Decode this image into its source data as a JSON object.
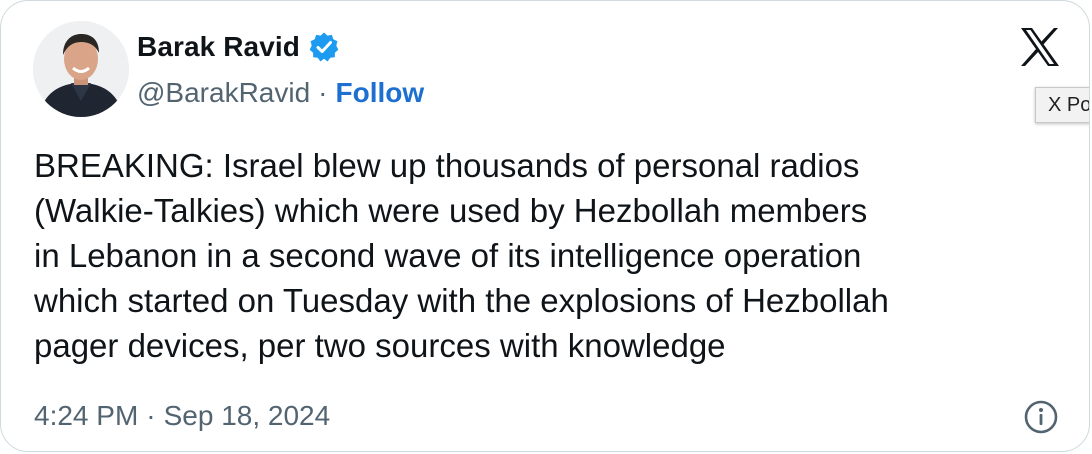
{
  "author": {
    "display_name": "Barak Ravid",
    "handle": "@BarakRavid",
    "separator": "·",
    "follow_label": "Follow",
    "verified_icon": "verified-badge-icon",
    "verified_color": "#1d9bf0"
  },
  "platform": {
    "logo_icon": "x-logo-icon",
    "tooltip": "X Po"
  },
  "tweet": {
    "lines": [
      "BREAKING: Israel blew up thousands of personal radios",
      "(Walkie-Talkies) which were used by Hezbollah members",
      "in Lebanon in a second wave of its intelligence operation",
      "which started on Tuesday with the explosions of Hezbollah",
      "pager devices, per two sources with knowledge"
    ]
  },
  "meta": {
    "time": "4:24 PM",
    "separator": "·",
    "date": "Sep 18, 2024",
    "info_icon": "info-icon"
  },
  "colors": {
    "text": "#0f1419",
    "muted": "#536471",
    "link": "#1d6fd1",
    "border": "#cfd9de"
  }
}
